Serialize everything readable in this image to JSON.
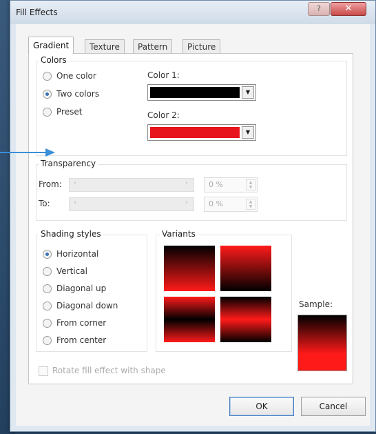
{
  "dialog": {
    "title": "Fill Effects",
    "help_label": "?",
    "close_label": "✕"
  },
  "tabs": [
    {
      "label": "Gradient",
      "active": true
    },
    {
      "label": "Texture",
      "active": false
    },
    {
      "label": "Pattern",
      "active": false
    },
    {
      "label": "Picture",
      "active": false
    }
  ],
  "colors": {
    "group_label": "Colors",
    "options": [
      {
        "label": "One color",
        "selected": false
      },
      {
        "label": "Two colors",
        "selected": true
      },
      {
        "label": "Preset",
        "selected": false
      }
    ],
    "color1_label": "Color 1:",
    "color1": "#000000",
    "color2_label": "Color 2:",
    "color2": "#e8141b"
  },
  "transparency": {
    "group_label": "Transparency",
    "from_label": "From:",
    "to_label": "To:",
    "from_value": "0 %",
    "to_value": "0 %"
  },
  "shading": {
    "group_label": "Shading styles",
    "options": [
      {
        "label": "Horizontal",
        "selected": true
      },
      {
        "label": "Vertical",
        "selected": false
      },
      {
        "label": "Diagonal up",
        "selected": false
      },
      {
        "label": "Diagonal down",
        "selected": false
      },
      {
        "label": "From corner",
        "selected": false
      },
      {
        "label": "From center",
        "selected": false
      }
    ]
  },
  "variants": {
    "group_label": "Variants"
  },
  "sample": {
    "label": "Sample:"
  },
  "rotate": {
    "label": "Rotate fill effect with shape",
    "checked": false
  },
  "buttons": {
    "ok": "OK",
    "cancel": "Cancel"
  }
}
